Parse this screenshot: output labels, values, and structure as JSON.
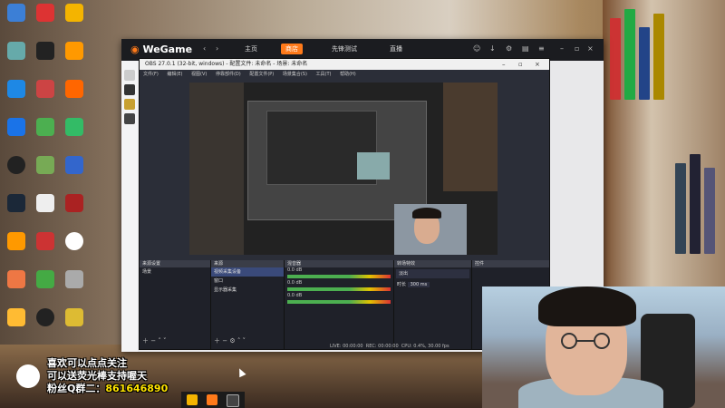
{
  "wegame": {
    "logo": "WeGame",
    "nav": [
      "主页",
      "商店",
      "先锋测试",
      "直播"
    ],
    "active_nav": "商店"
  },
  "obs": {
    "title": "OBS 27.0.1 (32-bit, windows) - 配置文件: 未命名 - 场景: 未命名",
    "menu": [
      "文件(F)",
      "编辑(E)",
      "视图(V)",
      "停靠部件(D)",
      "配置文件(P)",
      "场景集合(S)",
      "工具(T)",
      "帮助(H)"
    ],
    "panels": {
      "scenes_header": "来源设置",
      "scenes": [
        "场景"
      ],
      "sources_header": "来源",
      "sources": [
        "视频采集设备",
        "窗口",
        "显示器采集"
      ],
      "mixer_header": "混音器",
      "mixer_tracks": [
        {
          "name": "",
          "db": "0.0 dB"
        },
        {
          "name": "",
          "db": "0.0 dB"
        },
        {
          "name": "",
          "db": "0.0 dB"
        }
      ],
      "transitions_header": "转场特效",
      "transition_value": "淡出",
      "duration_label": "时长",
      "duration_value": "300 ms",
      "controls_header": "控件"
    },
    "status": {
      "live": "LIVE: 00:00:00",
      "rec": "REC: 00:00:00",
      "cpu": "CPU: 0.4%, 30.00 fps"
    }
  },
  "chat": {
    "line1": "喜欢可以点点关注",
    "line2": "可以送荧光棒支持喔天",
    "line3_prefix": "粉丝Q群二：",
    "line3_number": "861646890"
  },
  "colors": {
    "accent": "#ff7a1a",
    "obs_bg": "#2b2e38",
    "chat_highlight": "#ffe400"
  }
}
